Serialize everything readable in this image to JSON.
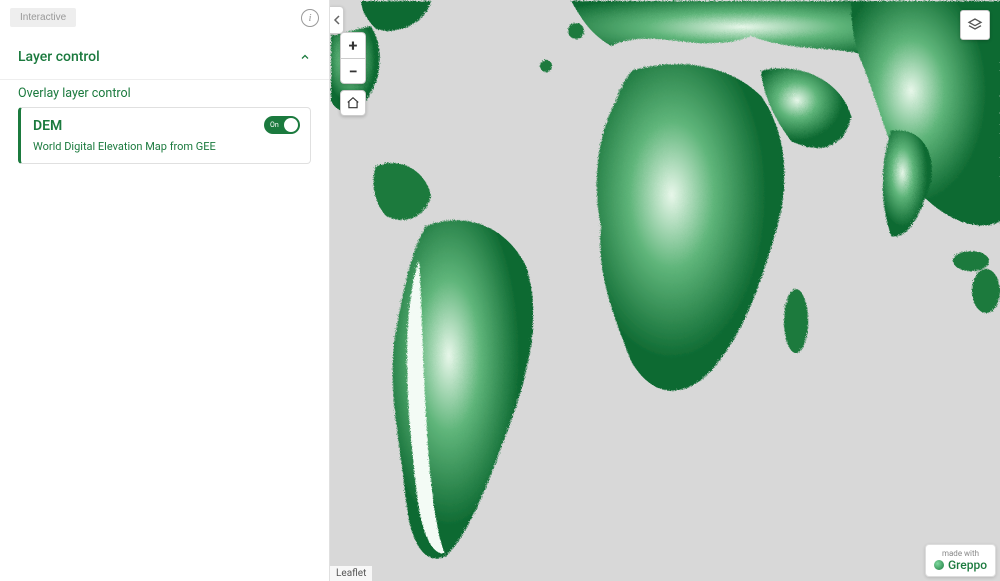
{
  "colors": {
    "accent": "#1b7a3e",
    "map_bg": "#d8d8d8"
  },
  "sidebar": {
    "header_button": "Interactive",
    "section_title": "Layer control",
    "subsection_title": "Overlay layer control",
    "layer": {
      "name": "DEM",
      "description": "World Digital Elevation Map from GEE",
      "toggle_label": "On",
      "toggle_state": true
    }
  },
  "map": {
    "zoom_in": "+",
    "zoom_out": "−",
    "attribution": "Leaflet",
    "made_with_label": "made with",
    "made_with_brand": "Greppo"
  }
}
